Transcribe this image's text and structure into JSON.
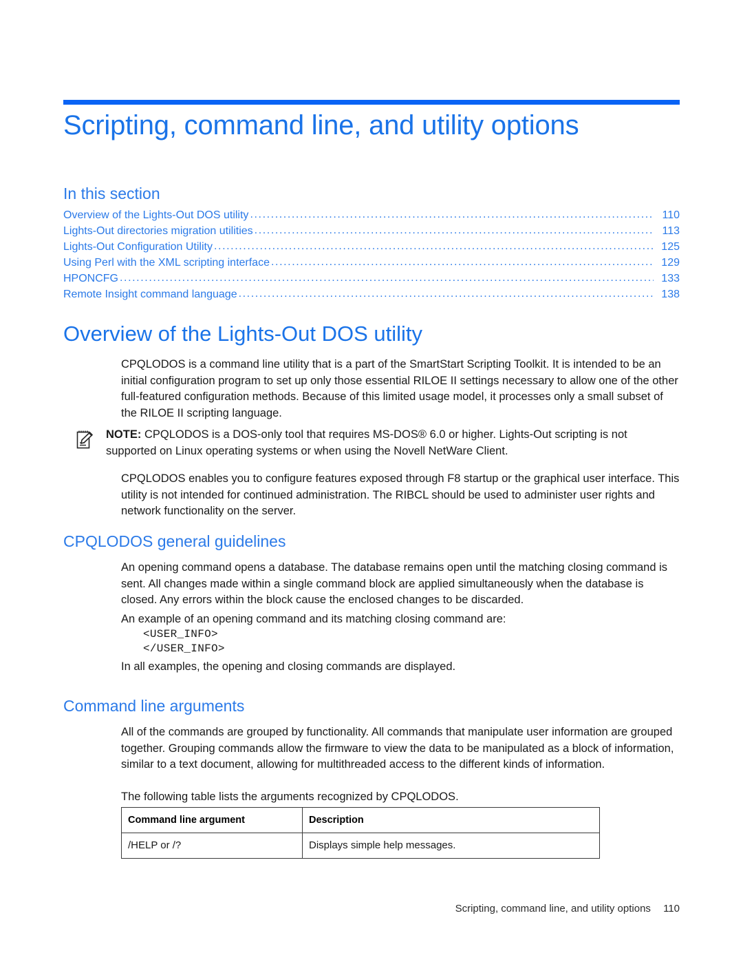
{
  "colors": {
    "rule": "#0a63f5",
    "title": "#1a73e8",
    "heading": "#2b7ae8",
    "body": "#1a1a1a"
  },
  "chapter": {
    "title": "Scripting, command line, and utility options"
  },
  "toc": {
    "heading": "In this section",
    "dots": "...........................................................................................................................................................",
    "entries": [
      {
        "label": "Overview of the Lights-Out DOS utility",
        "page": "110"
      },
      {
        "label": "Lights-Out directories migration utilities",
        "page": "113"
      },
      {
        "label": "Lights-Out Configuration Utility",
        "page": "125"
      },
      {
        "label": "Using Perl with the XML scripting interface",
        "page": "129"
      },
      {
        "label": "HPONCFG",
        "page": "133"
      },
      {
        "label": "Remote Insight command language",
        "page": "138"
      }
    ]
  },
  "sections": {
    "overview": {
      "heading": "Overview of the Lights-Out DOS utility",
      "paragraph1": "CPQLODOS is a command line utility that is a part of the SmartStart Scripting Toolkit. It is intended to be an initial configuration program to set up only those essential RILOE II settings necessary to allow one of the other full-featured configuration methods. Because of this limited usage model, it processes only a small subset of the RILOE II scripting language.",
      "note_label": "NOTE:",
      "note_text": "CPQLODOS is a DOS-only tool that requires MS-DOS® 6.0 or higher. Lights-Out scripting is not supported on Linux operating systems or when using the Novell NetWare Client.",
      "note_icon": "note-pencil-icon",
      "paragraph2": "CPQLODOS enables you to configure features exposed through F8 startup or the graphical user interface. This utility is not intended for continued administration. The RIBCL should be used to administer user rights and network functionality on the server."
    },
    "guidelines": {
      "heading": "CPQLODOS general guidelines",
      "paragraph1": "An opening command opens a database. The database remains open until the matching closing command is sent. All changes made within a single command block are applied simultaneously when the database is closed. Any errors within the block cause the enclosed changes to be discarded.",
      "paragraph2": "An example of an opening command and its matching closing command are:",
      "code_open": "<USER_INFO>",
      "code_close": "</USER_INFO>",
      "paragraph3": "In all examples, the opening and closing commands are displayed."
    },
    "arguments": {
      "heading": "Command line arguments",
      "paragraph1": "All of the commands are grouped by functionality. All commands that manipulate user information are grouped together. Grouping commands allow the firmware to view the data to be manipulated as a block of information, similar to a text document, allowing for multithreaded access to the different kinds of information.",
      "paragraph2": "The following table lists the arguments recognized by CPQLODOS.",
      "table": {
        "headers": [
          "Command line argument",
          "Description"
        ],
        "rows": [
          [
            "/HELP or /?",
            "Displays simple help messages."
          ]
        ]
      }
    }
  },
  "footer": {
    "text": "Scripting, command line, and utility options",
    "page": "110"
  }
}
